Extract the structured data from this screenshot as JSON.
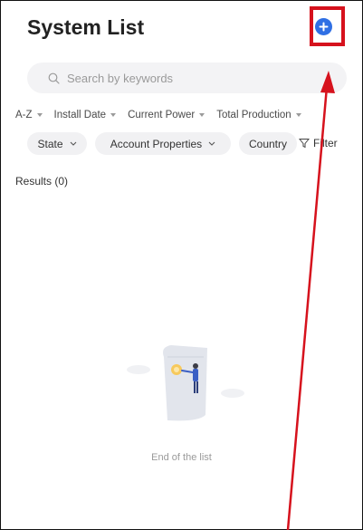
{
  "header": {
    "title": "System List",
    "add_icon": "plus-circle-icon"
  },
  "search": {
    "placeholder": "Search by keywords",
    "icon": "search-icon"
  },
  "sort_options": [
    {
      "label": "A-Z"
    },
    {
      "label": "Install Date"
    },
    {
      "label": "Current Power"
    },
    {
      "label": "Total Production"
    }
  ],
  "filter_chips": [
    {
      "label": "State"
    },
    {
      "label": "Account Properties"
    },
    {
      "label": "Country"
    }
  ],
  "filter": {
    "label": "Filter",
    "icon": "funnel-icon"
  },
  "results": {
    "label": "Results (0)"
  },
  "empty_state": {
    "message": "End of the list"
  },
  "colors": {
    "accent": "#2f6fe4",
    "annotation": "#d6121d",
    "chip_bg": "#f1f1f3",
    "muted_text": "#9a9a9a"
  }
}
